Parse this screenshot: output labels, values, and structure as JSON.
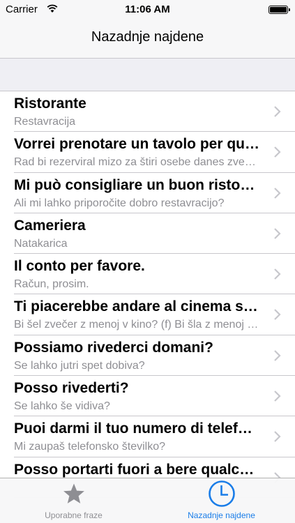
{
  "status_bar": {
    "carrier": "Carrier",
    "time": "11:06 AM"
  },
  "nav": {
    "title": "Nazadnje najdene"
  },
  "list": [
    {
      "title": "Ristorante",
      "subtitle": "Restavracija"
    },
    {
      "title": "Vorrei prenotare un tavolo per quattro persone.",
      "subtitle": "Rad bi rezerviral mizo za štiri osebe danes zvečer."
    },
    {
      "title": "Mi può consigliare un buon ristorante?",
      "subtitle": "Ali mi lahko priporočite dobro restavracijo?"
    },
    {
      "title": "Cameriera",
      "subtitle": "Natakarica"
    },
    {
      "title": "Il conto per favore.",
      "subtitle": "Račun, prosim."
    },
    {
      "title": "Ti piacerebbe andare al cinema stasera?",
      "subtitle": "Bi šel zvečer z menoj v kino? (f) Bi šla z menoj v kino?"
    },
    {
      "title": "Possiamo rivederci domani?",
      "subtitle": "Se lahko jutri spet dobiva?"
    },
    {
      "title": "Posso rivederti?",
      "subtitle": "Se lahko še vidiva?"
    },
    {
      "title": "Puoi darmi il tuo numero di telefono?",
      "subtitle": "Mi zaupaš telefonsko številko?"
    },
    {
      "title": "Posso portarti fuori a bere qualcosa?",
      "subtitle": ""
    }
  ],
  "tab_bar": {
    "tabs": [
      {
        "label": "Uporabne fraze",
        "icon": "star-icon",
        "selected": false
      },
      {
        "label": "Nazadnje najdene",
        "icon": "clock-icon",
        "selected": true
      }
    ]
  },
  "colors": {
    "accent": "#1a7de8",
    "inactive": "#8e8e93",
    "separator": "#c8c7cc",
    "section_bg": "#efeff4"
  }
}
